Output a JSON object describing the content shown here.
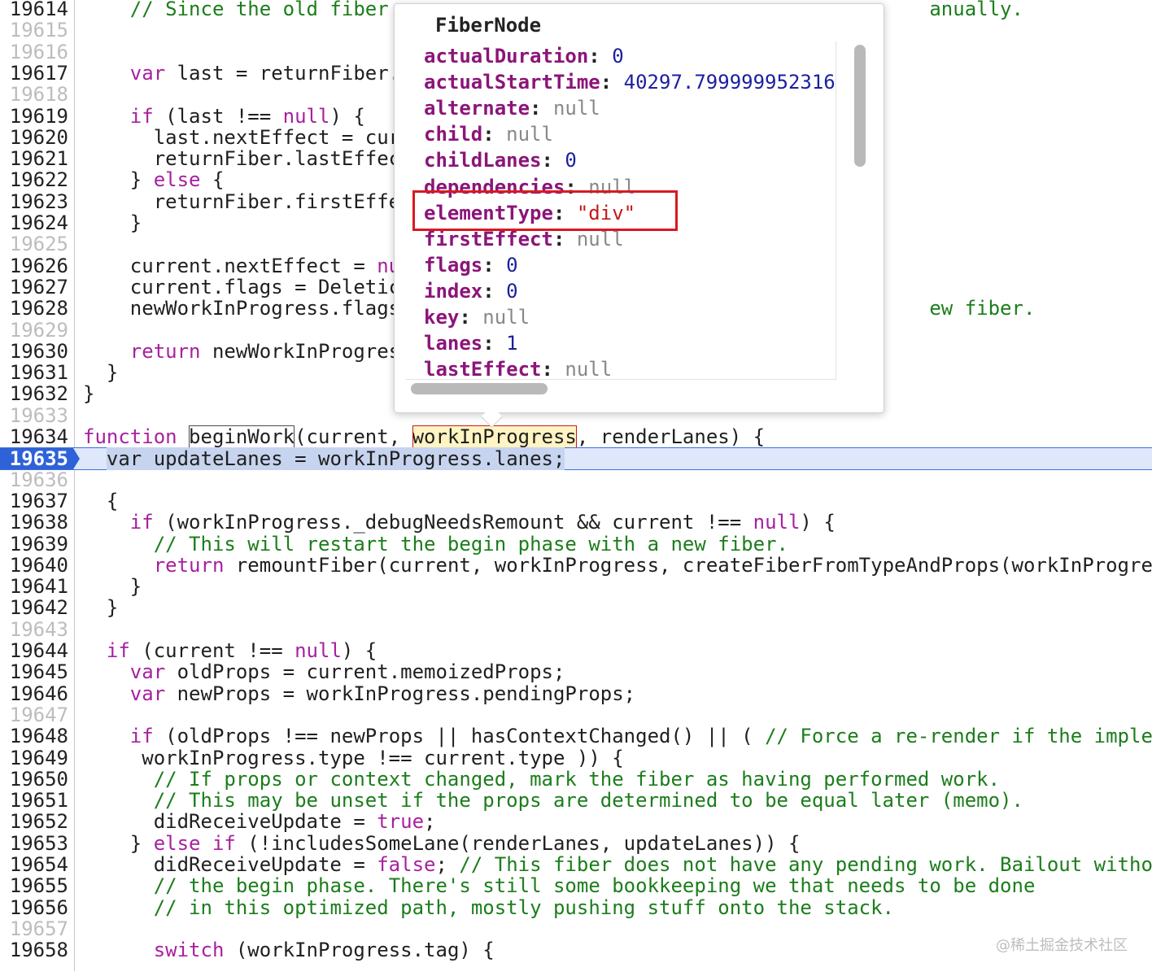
{
  "editor": {
    "lines": [
      {
        "num": "19614",
        "tokens": [
          {
            "t": "    "
          },
          {
            "t": "// Since the old fiber ",
            "c": "cm"
          },
          {
            "t": "                                             "
          },
          {
            "t": "anually.",
            "c": "cm"
          }
        ]
      },
      {
        "num": "19615",
        "tokens": []
      },
      {
        "num": "19616",
        "tokens": []
      },
      {
        "num": "19617",
        "tokens": [
          {
            "t": "    "
          },
          {
            "t": "var",
            "c": "kw"
          },
          {
            "t": " last = returnFiber."
          }
        ]
      },
      {
        "num": "19618",
        "tokens": []
      },
      {
        "num": "19619",
        "tokens": [
          {
            "t": "    "
          },
          {
            "t": "if",
            "c": "kw"
          },
          {
            "t": " (last !== "
          },
          {
            "t": "null",
            "c": "kw"
          },
          {
            "t": ") {"
          }
        ]
      },
      {
        "num": "19620",
        "tokens": [
          {
            "t": "      last.nextEffect = cur"
          }
        ]
      },
      {
        "num": "19621",
        "tokens": [
          {
            "t": "      returnFiber.lastEffec"
          }
        ]
      },
      {
        "num": "19622",
        "tokens": [
          {
            "t": "    } "
          },
          {
            "t": "else",
            "c": "kw"
          },
          {
            "t": " {"
          }
        ]
      },
      {
        "num": "19623",
        "tokens": [
          {
            "t": "      returnFiber.firstEffe"
          }
        ]
      },
      {
        "num": "19624",
        "tokens": [
          {
            "t": "    }"
          }
        ]
      },
      {
        "num": "19625",
        "tokens": []
      },
      {
        "num": "19626",
        "tokens": [
          {
            "t": "    current.nextEffect = "
          },
          {
            "t": "nu",
            "c": "kw"
          }
        ]
      },
      {
        "num": "19627",
        "tokens": [
          {
            "t": "    current.flags = Deletic"
          }
        ]
      },
      {
        "num": "19628",
        "tokens": [
          {
            "t": "    newWorkInProgress.flags"
          },
          {
            "t": "                                             "
          },
          {
            "t": "ew fiber.",
            "c": "cm"
          }
        ]
      },
      {
        "num": "19629",
        "tokens": []
      },
      {
        "num": "19630",
        "tokens": [
          {
            "t": "    "
          },
          {
            "t": "return",
            "c": "kw"
          },
          {
            "t": " newWorkInProgres"
          }
        ]
      },
      {
        "num": "19631",
        "tokens": [
          {
            "t": "  }"
          }
        ]
      },
      {
        "num": "19632",
        "tokens": [
          {
            "t": "}"
          }
        ]
      },
      {
        "num": "19633",
        "tokens": []
      },
      {
        "num": "19634",
        "tokens": [
          {
            "t": "function",
            "c": "kw"
          },
          {
            "t": " "
          },
          {
            "t": "beginWork",
            "c": "boxplain"
          },
          {
            "t": "(current, "
          },
          {
            "t": "workInProgress",
            "c": "boxhl"
          },
          {
            "t": ", renderLanes) {"
          }
        ]
      },
      {
        "num": "19635",
        "active": true,
        "tokens": [
          {
            "t": "  "
          },
          {
            "t": "var",
            "c": "kwsel"
          },
          {
            "t": " updateLanes = workInProgress.lanes;",
            "c": "sel"
          }
        ]
      },
      {
        "num": "19636",
        "tokens": []
      },
      {
        "num": "19637",
        "tokens": [
          {
            "t": "  {"
          }
        ]
      },
      {
        "num": "19638",
        "tokens": [
          {
            "t": "    "
          },
          {
            "t": "if",
            "c": "kw"
          },
          {
            "t": " (workInProgress._debugNeedsRemount && current !== "
          },
          {
            "t": "null",
            "c": "kw"
          },
          {
            "t": ") {"
          }
        ]
      },
      {
        "num": "19639",
        "tokens": [
          {
            "t": "      "
          },
          {
            "t": "// This will restart the begin phase with a new fiber.",
            "c": "cm"
          }
        ]
      },
      {
        "num": "19640",
        "tokens": [
          {
            "t": "      "
          },
          {
            "t": "return",
            "c": "kw"
          },
          {
            "t": " remountFiber(current, workInProgress, createFiberFromTypeAndProps(workInProgre"
          }
        ]
      },
      {
        "num": "19641",
        "tokens": [
          {
            "t": "    }"
          }
        ]
      },
      {
        "num": "19642",
        "tokens": [
          {
            "t": "  }"
          }
        ]
      },
      {
        "num": "19643",
        "tokens": []
      },
      {
        "num": "19644",
        "tokens": [
          {
            "t": "  "
          },
          {
            "t": "if",
            "c": "kw"
          },
          {
            "t": " (current !== "
          },
          {
            "t": "null",
            "c": "kw"
          },
          {
            "t": ") {"
          }
        ]
      },
      {
        "num": "19645",
        "tokens": [
          {
            "t": "    "
          },
          {
            "t": "var",
            "c": "kw"
          },
          {
            "t": " oldProps = current.memoizedProps;"
          }
        ]
      },
      {
        "num": "19646",
        "tokens": [
          {
            "t": "    "
          },
          {
            "t": "var",
            "c": "kw"
          },
          {
            "t": " newProps = workInProgress.pendingProps;"
          }
        ]
      },
      {
        "num": "19647",
        "tokens": []
      },
      {
        "num": "19648",
        "tokens": [
          {
            "t": "    "
          },
          {
            "t": "if",
            "c": "kw"
          },
          {
            "t": " (oldProps !== newProps || hasContextChanged() || ( "
          },
          {
            "t": "// Force a re-render if the imple",
            "c": "cm"
          }
        ]
      },
      {
        "num": "19649",
        "tokens": [
          {
            "t": "     workInProgress.type !== current.type )) {"
          }
        ]
      },
      {
        "num": "19650",
        "tokens": [
          {
            "t": "      "
          },
          {
            "t": "// If props or context changed, mark the fiber as having performed work.",
            "c": "cm"
          }
        ]
      },
      {
        "num": "19651",
        "tokens": [
          {
            "t": "      "
          },
          {
            "t": "// This may be unset if the props are determined to be equal later (memo).",
            "c": "cm"
          }
        ]
      },
      {
        "num": "19652",
        "tokens": [
          {
            "t": "      didReceiveUpdate = "
          },
          {
            "t": "true",
            "c": "kw"
          },
          {
            "t": ";"
          }
        ]
      },
      {
        "num": "19653",
        "tokens": [
          {
            "t": "    } "
          },
          {
            "t": "else if",
            "c": "kw"
          },
          {
            "t": " (!includesSomeLane(renderLanes, updateLanes)) {"
          }
        ]
      },
      {
        "num": "19654",
        "tokens": [
          {
            "t": "      didReceiveUpdate = "
          },
          {
            "t": "false",
            "c": "kw"
          },
          {
            "t": "; "
          },
          {
            "t": "// This fiber does not have any pending work. Bailout witho",
            "c": "cm"
          }
        ]
      },
      {
        "num": "19655",
        "tokens": [
          {
            "t": "      "
          },
          {
            "t": "// the begin phase. There's still some bookkeeping we that needs to be done",
            "c": "cm"
          }
        ]
      },
      {
        "num": "19656",
        "tokens": [
          {
            "t": "      "
          },
          {
            "t": "// in this optimized path, mostly pushing stuff onto the stack.",
            "c": "cm"
          }
        ]
      },
      {
        "num": "19657",
        "tokens": []
      },
      {
        "num": "19658",
        "tokens": [
          {
            "t": "      "
          },
          {
            "t": "switch",
            "c": "kw"
          },
          {
            "t": " (workInProgress.tag) {"
          }
        ]
      }
    ]
  },
  "popover": {
    "title": "FiberNode",
    "properties": [
      {
        "key": "actualDuration",
        "value": "0",
        "type": "num"
      },
      {
        "key": "actualStartTime",
        "value": "40297.799999952316",
        "type": "num"
      },
      {
        "key": "alternate",
        "value": "null",
        "type": "null"
      },
      {
        "key": "child",
        "value": "null",
        "type": "null"
      },
      {
        "key": "childLanes",
        "value": "0",
        "type": "num"
      },
      {
        "key": "dependencies",
        "value": "null",
        "type": "null"
      },
      {
        "key": "elementType",
        "value": "\"div\"",
        "type": "str"
      },
      {
        "key": "firstEffect",
        "value": "null",
        "type": "null"
      },
      {
        "key": "flags",
        "value": "0",
        "type": "num"
      },
      {
        "key": "index",
        "value": "0",
        "type": "num"
      },
      {
        "key": "key",
        "value": "null",
        "type": "null"
      },
      {
        "key": "lanes",
        "value": "1",
        "type": "num"
      },
      {
        "key": "lastEffect",
        "value": "null",
        "type": "null"
      }
    ]
  },
  "watermark": "@稀土掘金技术社区",
  "colors": {
    "keyword": "#a7219f",
    "comment": "#1c7d1c",
    "highlight_box": "#d81921",
    "active_line": "#dfe8fb",
    "active_gutter": "#2f62d8"
  }
}
